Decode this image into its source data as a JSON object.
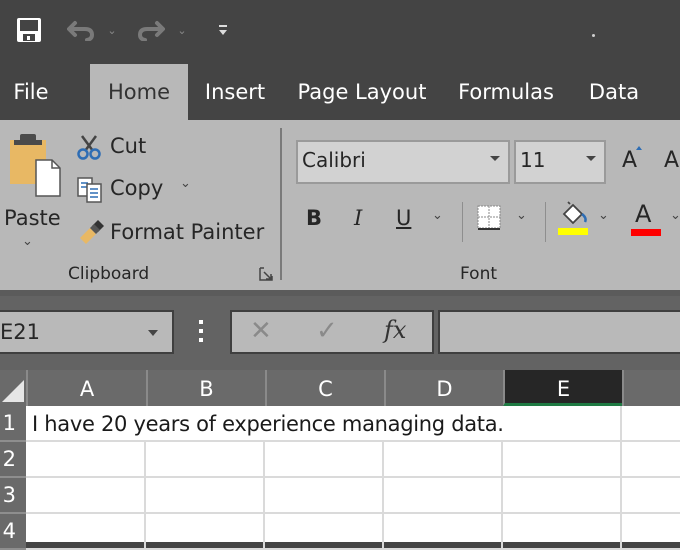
{
  "quick_access": {
    "save_icon": "floppy-disk-icon",
    "undo_icon": "undo-icon",
    "redo_icon": "redo-icon",
    "customize_icon": "customize-qat-icon"
  },
  "tabs": [
    {
      "label": "File",
      "active": false
    },
    {
      "label": "Home",
      "active": true
    },
    {
      "label": "Insert",
      "active": false
    },
    {
      "label": "Page Layout",
      "active": false
    },
    {
      "label": "Formulas",
      "active": false
    },
    {
      "label": "Data",
      "active": false
    }
  ],
  "ribbon": {
    "clipboard": {
      "paste_label": "Paste",
      "cut_label": "Cut",
      "copy_label": "Copy",
      "format_painter_label": "Format Painter",
      "group_label": "Clipboard"
    },
    "font": {
      "font_name": "Calibri",
      "font_size": "11",
      "bold_label": "B",
      "italic_label": "I",
      "underline_label": "U",
      "font_color_glyph": "A",
      "grow_glyph": "A",
      "shrink_glyph": "A",
      "highlight_color": "#ffff00",
      "font_color": "#ff0000",
      "group_label": "Font"
    }
  },
  "formula_bar": {
    "name_box": "E21",
    "cancel_glyph": "✕",
    "enter_glyph": "✓",
    "fx_label": "fx",
    "formula_value": ""
  },
  "sheet": {
    "columns": [
      "A",
      "B",
      "C",
      "D",
      "E",
      ""
    ],
    "selected_column": "E",
    "rows": [
      "1",
      "2",
      "3",
      "4"
    ],
    "cells": {
      "A1": "I have 20 years of experience managing data."
    }
  },
  "colors": {
    "selection_accent": "#1f7a43"
  }
}
